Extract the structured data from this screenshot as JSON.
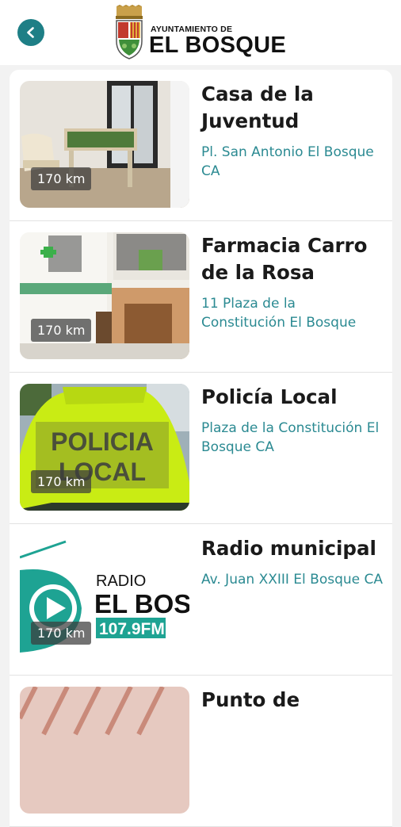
{
  "header": {
    "back_icon": "chevron-left-icon",
    "logo": {
      "small": "AYUNTAMIENTO DE",
      "big": "EL BOSQUE"
    },
    "accent_color": "#1e7f86"
  },
  "places": [
    {
      "title": "Casa de la Juventud",
      "address": "Pl. San Antonio El Bosque CA",
      "distance": "170 km"
    },
    {
      "title": "Farmacia Carro de la Rosa",
      "address": "11 Plaza de la Constitución El Bosque",
      "distance": "170 km"
    },
    {
      "title": "Policía Local",
      "address": "Plaza de la Constitución El Bosque CA",
      "distance": "170 km",
      "image_text": [
        "POLICIA",
        "LOCAL"
      ]
    },
    {
      "title": "Radio municipal",
      "address": "Av. Juan XXIII El Bosque CA",
      "distance": "170 km",
      "image_text": [
        "RADIO",
        "EL BOSQ",
        "107.9FM"
      ]
    },
    {
      "title": "Punto de",
      "address": "",
      "distance": ""
    }
  ]
}
